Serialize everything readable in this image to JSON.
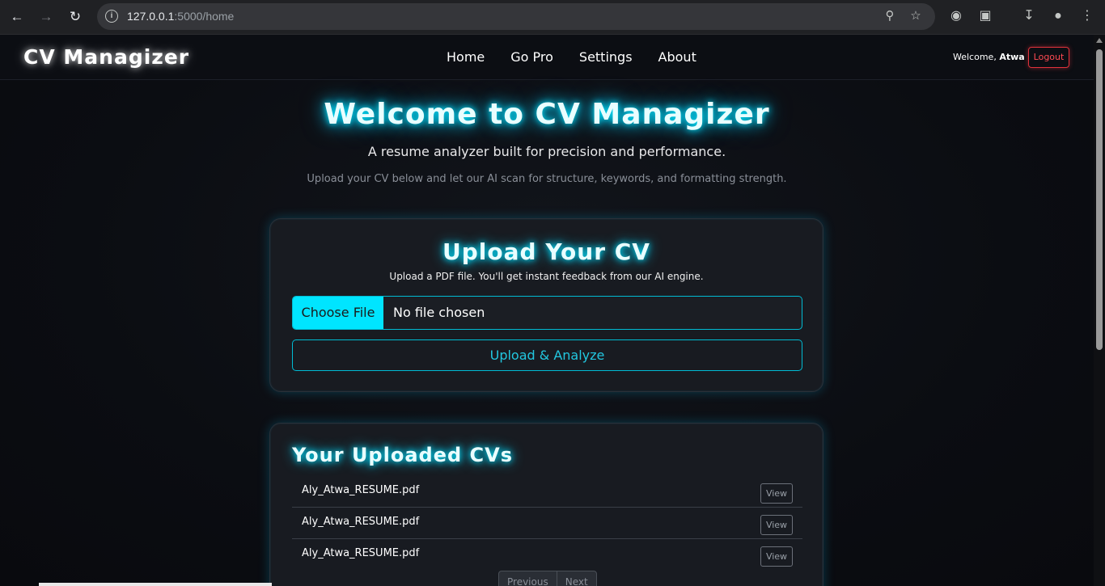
{
  "browser": {
    "url_host": "127.0.0.1",
    "url_path": ":5000/home"
  },
  "nav": {
    "brand": "CV Managizer",
    "items": [
      {
        "label": "Home"
      },
      {
        "label": "Go Pro"
      },
      {
        "label": "Settings"
      },
      {
        "label": "About"
      }
    ],
    "welcome_prefix": "Welcome,",
    "username": "Atwa",
    "logout_label": "Logout"
  },
  "hero": {
    "title": "Welcome to CV Managizer",
    "subtitle": "A resume analyzer built for precision and performance.",
    "description": "Upload your CV below and let our AI scan for structure, keywords, and formatting strength."
  },
  "upload": {
    "title": "Upload Your CV",
    "note": "Upload a PDF file. You'll get instant feedback from our AI engine.",
    "choose_label": "Choose File",
    "file_status": "No file chosen",
    "submit_label": "Upload & Analyze"
  },
  "uploads": {
    "title": "Your Uploaded CVs",
    "files": [
      {
        "name": "Aly_Atwa_RESUME.pdf",
        "action": "View"
      },
      {
        "name": "Aly_Atwa_RESUME.pdf",
        "action": "View"
      },
      {
        "name": "Aly_Atwa_RESUME.pdf",
        "action": "View"
      }
    ],
    "prev_label": "Previous",
    "next_label": "Next"
  },
  "colors": {
    "accent": "#00e5ff",
    "danger": "#e0323b",
    "background": "#0b0d12"
  }
}
